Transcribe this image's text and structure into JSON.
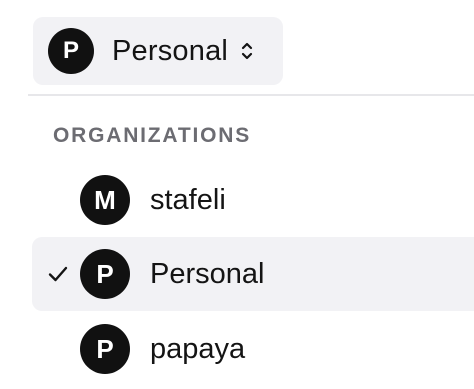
{
  "switcher": {
    "avatar_letter": "P",
    "label": "Personal",
    "icon": "chevron-up-down-icon"
  },
  "menu": {
    "section_heading": "ORGANIZATIONS",
    "items": [
      {
        "avatar_letter": "M",
        "label": "stafeli",
        "selected": false
      },
      {
        "avatar_letter": "P",
        "label": "Personal",
        "selected": true
      },
      {
        "avatar_letter": "P",
        "label": "papaya",
        "selected": false
      }
    ]
  },
  "colors": {
    "avatar_bg": "#111111",
    "selected_bg": "#f2f2f5",
    "heading": "#6c6c72"
  }
}
